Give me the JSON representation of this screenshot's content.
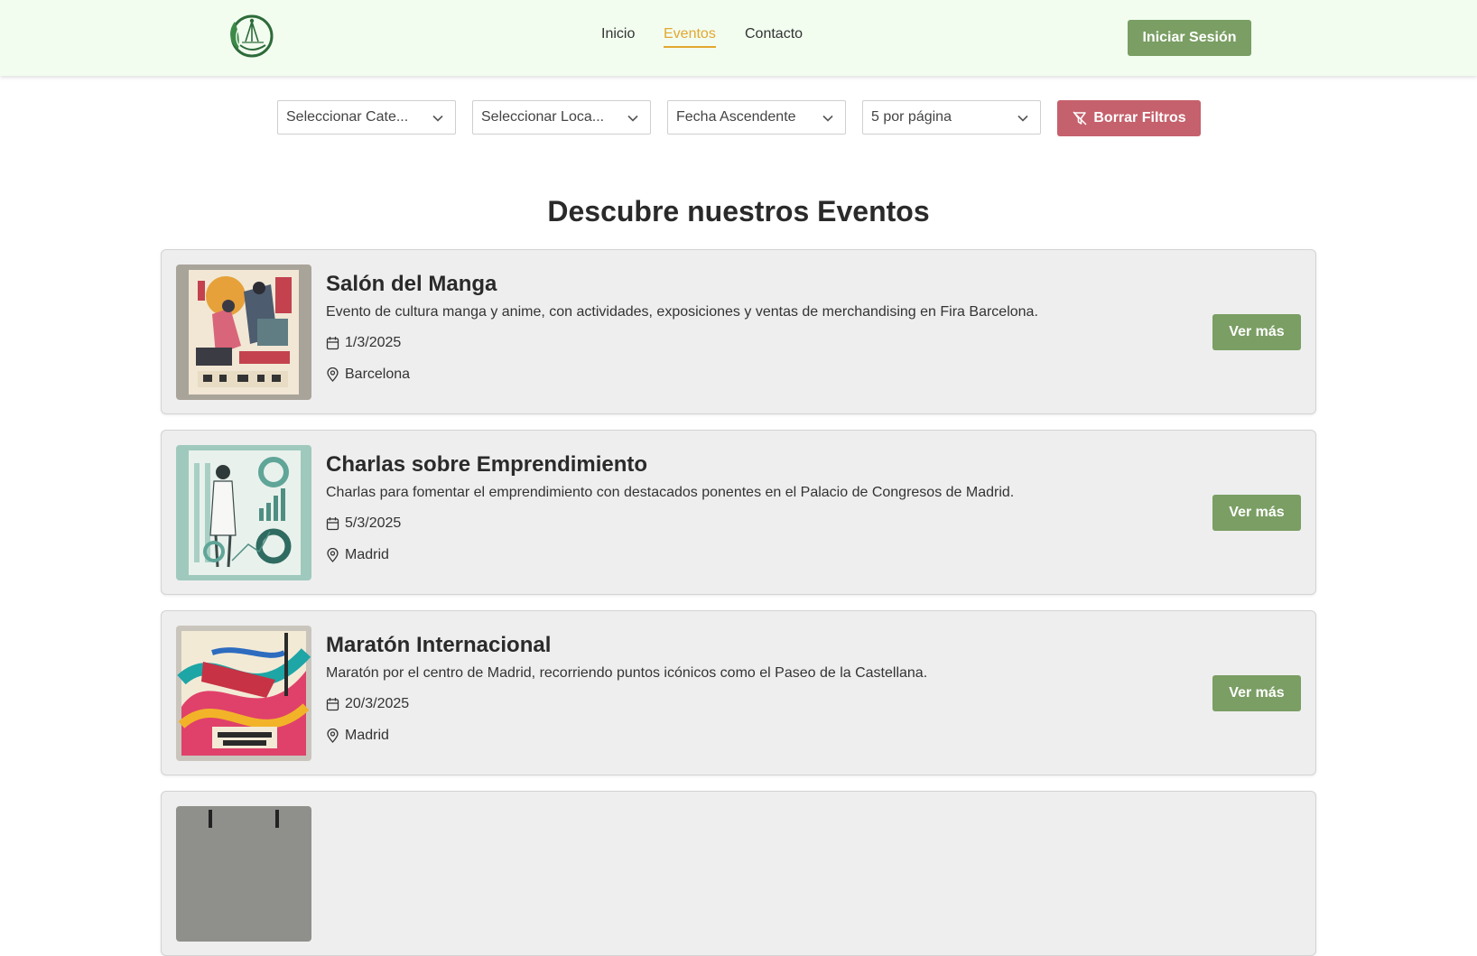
{
  "nav": {
    "items": [
      "Inicio",
      "Eventos",
      "Contacto"
    ],
    "active": "Eventos",
    "login_label": "Iniciar Sesión"
  },
  "filters": {
    "category": "Seleccionar Cate...",
    "location": "Seleccionar Loca...",
    "sort": "Fecha Ascendente",
    "per_page": "5 por página",
    "clear_label": "Borrar Filtros"
  },
  "page_title": "Descubre nuestros Eventos",
  "events": [
    {
      "title": "Salón del Manga",
      "description": "Evento de cultura manga y anime, con actividades, exposiciones y ventas de merchandising en Fira Barcelona.",
      "date": "1/3/2025",
      "location": "Barcelona",
      "button": "Ver más"
    },
    {
      "title": "Charlas sobre Emprendimiento",
      "description": "Charlas para fomentar el emprendimiento con destacados ponentes en el Palacio de Congresos de Madrid.",
      "date": "5/3/2025",
      "location": "Madrid",
      "button": "Ver más"
    },
    {
      "title": "Maratón Internacional",
      "description": "Maratón por el centro de Madrid, recorriendo puntos icónicos como el Paseo de la Castellana.",
      "date": "20/3/2025",
      "location": "Madrid",
      "button": "Ver más"
    }
  ],
  "colors": {
    "header_bg": "#f2fdf0",
    "primary": "#7a9e63",
    "danger": "#c5616c",
    "active_nav": "#e3a72f",
    "card_bg": "#eeeeee"
  },
  "icons": {
    "logo": "leaf-logo-icon",
    "chevron": "chevron-down-icon",
    "filter_clear": "filter-off-icon",
    "date": "calendar-icon",
    "location": "map-pin-icon"
  }
}
